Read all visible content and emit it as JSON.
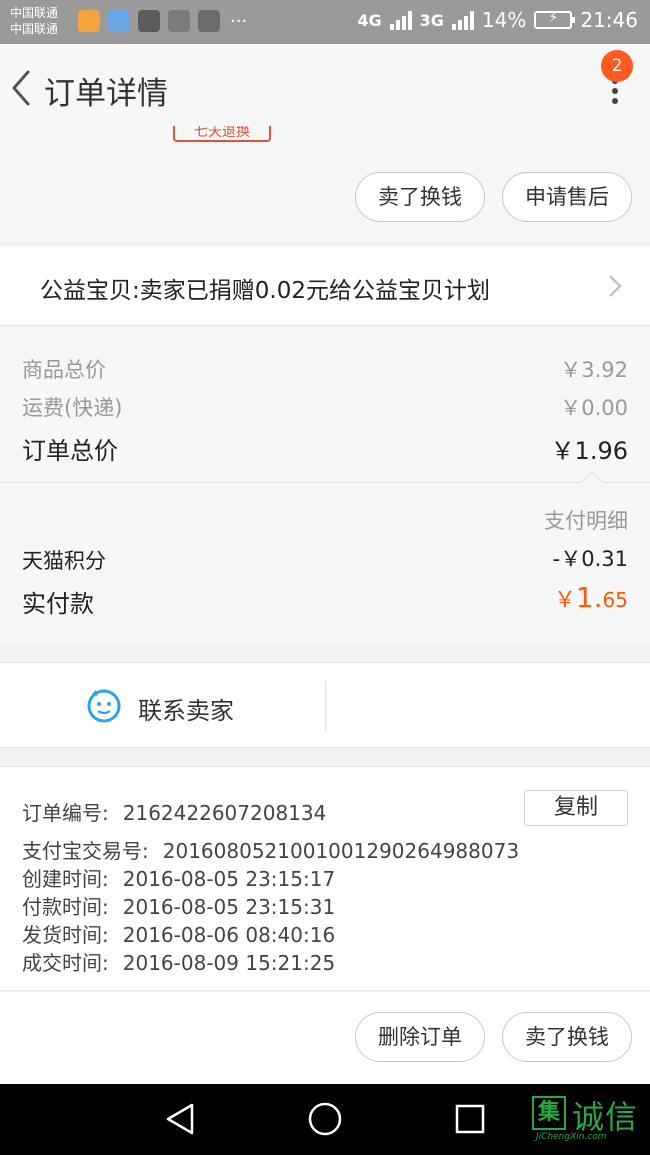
{
  "status_bar": {
    "carrier_1": "中国联通",
    "carrier_2": "中国联通",
    "more": "···",
    "network_1": "4G",
    "network_2": "3G",
    "battery": "14%",
    "time": "21:46"
  },
  "header": {
    "title": "订单详情",
    "badge": "2"
  },
  "service_tag": "七天退换",
  "top_actions": {
    "sell": "卖了换钱",
    "after_sale": "申请售后"
  },
  "charity": {
    "text": "公益宝贝:卖家已捐赠0.02元给公益宝贝计划"
  },
  "prices": {
    "goods_total_label": "商品总价",
    "goods_total_value": "￥3.92",
    "shipping_label": "运费(快递)",
    "shipping_value": "￥0.00",
    "order_total_label": "订单总价",
    "order_total_value": "￥1.96"
  },
  "payment": {
    "detail_link": "支付明细",
    "points_label": "天猫积分",
    "points_value": "-￥0.31",
    "paid_label": "实付款",
    "paid_currency": "￥",
    "paid_int": "1.",
    "paid_dec": "65"
  },
  "contact": {
    "label": "联系卖家"
  },
  "order_info": {
    "copy": "复制",
    "rows": [
      {
        "label": "订单编号:",
        "value": "2162422607208134"
      },
      {
        "label": "支付宝交易号:",
        "value": "2016080521001001290264988073"
      },
      {
        "label": "创建时间:",
        "value": "2016-08-05 23:15:17"
      },
      {
        "label": "付款时间:",
        "value": "2016-08-05 23:15:31"
      },
      {
        "label": "发货时间:",
        "value": "2016-08-06 08:40:16"
      },
      {
        "label": "成交时间:",
        "value": "2016-08-09 15:21:25"
      }
    ]
  },
  "bottom_actions": {
    "delete": "删除订单",
    "sell": "卖了换钱"
  },
  "watermark": {
    "logo": "集",
    "text": "诚信",
    "url": "JiChengXin.com"
  },
  "colors": {
    "accent": "#ff5a00",
    "badge": "#ff5a1f",
    "chat_icon": "#2aa3e8"
  }
}
